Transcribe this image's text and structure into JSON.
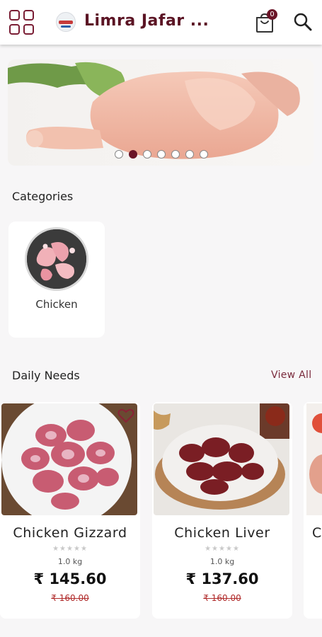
{
  "header": {
    "store_name": "Limra Jafar ...",
    "cart_count": "0",
    "icons": {
      "menu": "grid-menu-icon",
      "cart": "shopping-bag-icon",
      "search": "search-icon",
      "logo": "store-logo"
    }
  },
  "banner": {
    "slide_count": 7,
    "active_index": 1
  },
  "categories": {
    "title": "Categories",
    "items": [
      {
        "label": "Chicken"
      }
    ]
  },
  "daily_needs": {
    "title": "Daily Needs",
    "view_all": "View All",
    "products": [
      {
        "name": "Chicken Gizzard",
        "rating": 0,
        "weight": "1.0 kg",
        "price": "₹ 145.60",
        "mrp": "₹ 160.00"
      },
      {
        "name": "Chicken Liver",
        "rating": 0,
        "weight": "1.0 kg",
        "price": "₹ 137.60",
        "mrp": "₹ 160.00"
      },
      {
        "name": "C"
      }
    ]
  },
  "colors": {
    "brand": "#6a1427",
    "title": "#5b1424",
    "strike_price": "#b02a2a",
    "background": "#f7f6f7"
  }
}
